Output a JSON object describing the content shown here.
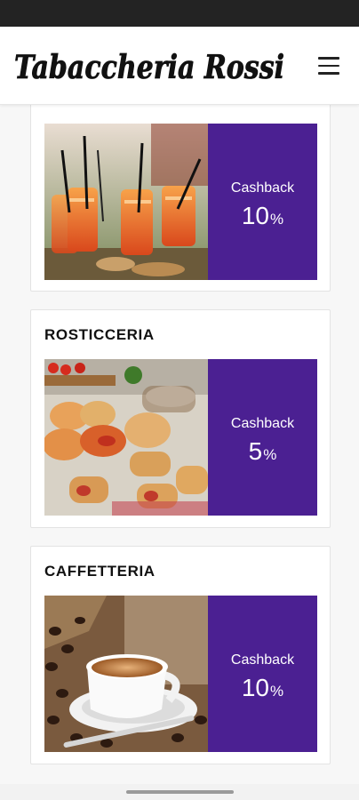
{
  "header": {
    "brand": "Tabaccheria Rossi",
    "menu_icon": "hamburger-menu-icon"
  },
  "categories": [
    {
      "title": "",
      "image": "spritz-cocktails-photo",
      "cashback_label": "Cashback",
      "cashback_value": "10",
      "cashback_unit": "%"
    },
    {
      "title": "ROSTICCERIA",
      "image": "pastries-pizzette-photo",
      "cashback_label": "Cashback",
      "cashback_value": "5",
      "cashback_unit": "%"
    },
    {
      "title": "CAFFETTERIA",
      "image": "coffee-cup-photo",
      "cashback_label": "Cashback",
      "cashback_value": "10",
      "cashback_unit": "%"
    }
  ],
  "colors": {
    "accent": "#4b2092",
    "status_bar": "#232323"
  }
}
